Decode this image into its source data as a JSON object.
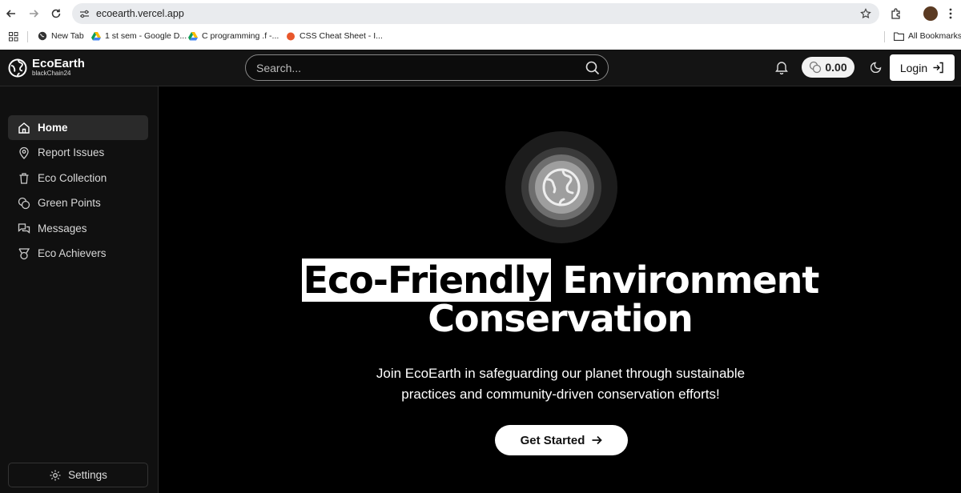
{
  "browser": {
    "url": "ecoearth.vercel.app",
    "bookmarks": [
      {
        "label": "New Tab"
      },
      {
        "label": "1 st sem - Google D..."
      },
      {
        "label": "C programming .f -..."
      },
      {
        "label": "CSS Cheat Sheet - I..."
      }
    ],
    "all_bookmarks": "All Bookmarks"
  },
  "header": {
    "brand": "EcoEarth",
    "brand_sub": "blackChain24",
    "search_placeholder": "Search...",
    "balance": "0.00",
    "login_label": "Login"
  },
  "sidebar": {
    "items": [
      {
        "label": "Home",
        "icon": "home-icon"
      },
      {
        "label": "Report Issues",
        "icon": "map-pin-icon"
      },
      {
        "label": "Eco Collection",
        "icon": "trash-icon"
      },
      {
        "label": "Green Points",
        "icon": "coins-icon"
      },
      {
        "label": "Messages",
        "icon": "messages-icon"
      },
      {
        "label": "Eco Achievers",
        "icon": "medal-icon"
      }
    ],
    "settings_label": "Settings"
  },
  "hero": {
    "title_highlight": "Eco-Friendly",
    "title_rest": " Environment",
    "title_line2": "Conservation",
    "subtitle": "Join EcoEarth in safeguarding our planet through sustainable practices and community-driven conservation efforts!",
    "cta_label": "Get Started"
  },
  "colors": {
    "background": "#000000",
    "header": "#141414",
    "sidebar": "#101010",
    "active_item": "#2a2a2a",
    "accent": "#ffffff"
  }
}
